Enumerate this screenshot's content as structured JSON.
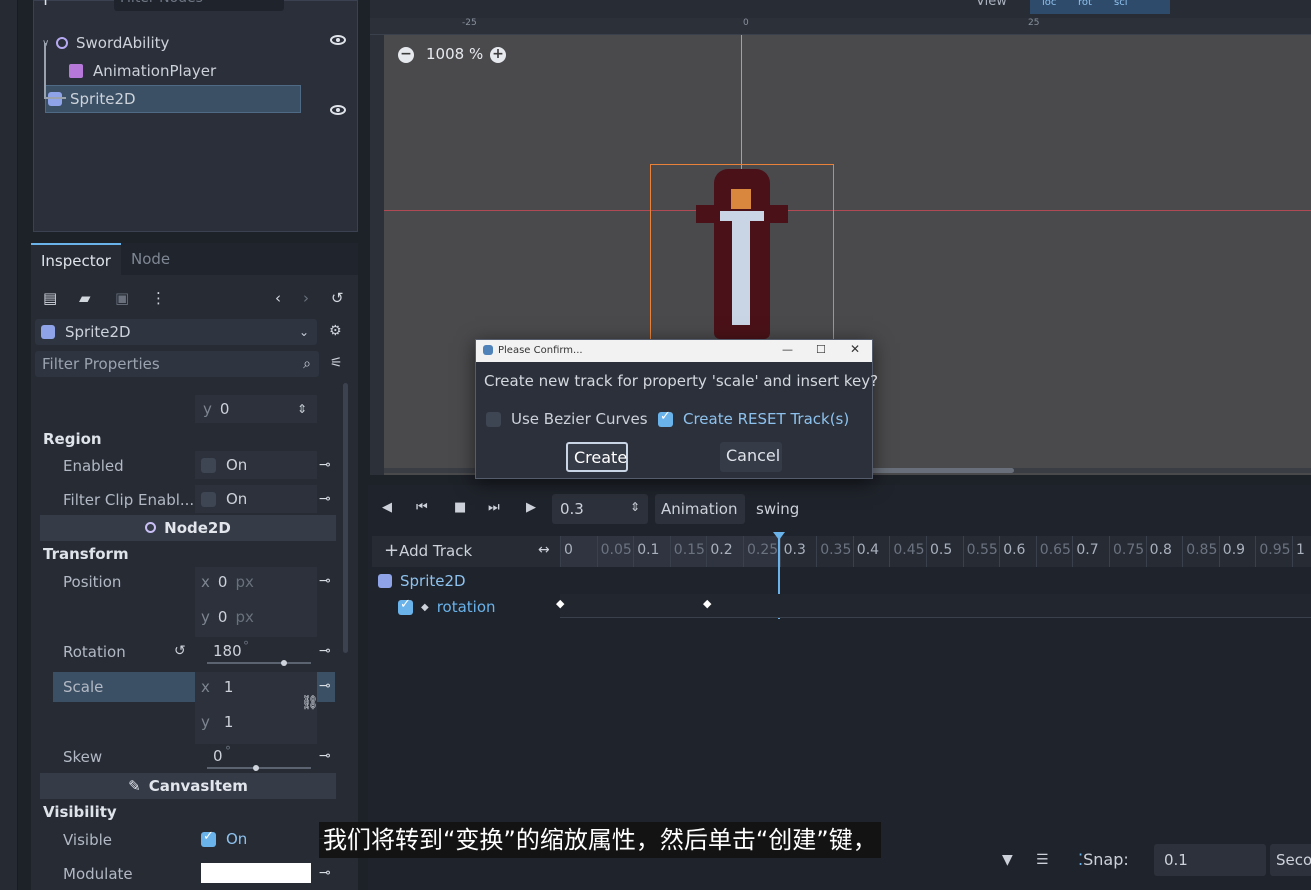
{
  "scene": {
    "filter_placeholder": "Filter Nodes",
    "tree": [
      {
        "label": "SwordAbility",
        "icon": "node-circle-icon"
      },
      {
        "label": "AnimationPlayer",
        "icon": "animation-player-icon"
      },
      {
        "label": "Sprite2D",
        "icon": "sprite2d-icon"
      }
    ]
  },
  "inspector": {
    "tabs": [
      "Inspector",
      "Node"
    ],
    "node_type": "Sprite2D",
    "filter_placeholder": "Filter Properties",
    "frame_y": {
      "axis": "y",
      "value": "0"
    },
    "region": {
      "title": "Region",
      "enabled_label": "Enabled",
      "enabled_value": "On",
      "filter_clip_label": "Filter Clip Enabl...",
      "filter_clip_value": "On"
    },
    "node2d_category": "Node2D",
    "transform": {
      "title": "Transform",
      "position_label": "Position",
      "position_x": "0",
      "position_y": "0",
      "unit_px": "px",
      "rotation_label": "Rotation",
      "rotation_value": "180",
      "degree": "°",
      "scale_label": "Scale",
      "scale_x": "1",
      "scale_y": "1",
      "skew_label": "Skew",
      "skew_value": "0",
      "x": "x",
      "y": "y"
    },
    "canvasitem_category": "CanvasItem",
    "visibility": {
      "title": "Visibility",
      "visible_label": "Visible",
      "visible_value": "On",
      "modulate_label": "Modulate",
      "modulate_color": "#ffffff"
    }
  },
  "viewport": {
    "top_menu": "View",
    "tools": [
      "loc",
      "rot",
      "scl"
    ],
    "ruler_labels": [
      "-25",
      "0",
      "25"
    ],
    "zoom": "1008 %",
    "colors": {
      "sprite_dark": "#4a1218",
      "sprite_blade": "#c9d4e4",
      "selection": "#e8823b"
    }
  },
  "dialog": {
    "title": "Please Confirm...",
    "message": "Create new track for property 'scale' and insert key?",
    "bezier_label": "Use Bezier Curves",
    "bezier_checked": false,
    "reset_label": "Create RESET Track(s)",
    "reset_checked": true,
    "create_label": "Create",
    "cancel_label": "Cancel"
  },
  "animation": {
    "time_value": "0.3",
    "animation_label": "Animation",
    "animation_name": "swing",
    "add_track_label": "Add Track",
    "ticks": [
      "0",
      "0.05",
      "0.1",
      "0.15",
      "0.2",
      "0.25",
      "0.3",
      "0.35",
      "0.4",
      "0.45",
      "0.5",
      "0.55",
      "0.6",
      "0.65",
      "0.7",
      "0.75",
      "0.8",
      "0.85",
      "0.9",
      "0.95",
      "1"
    ],
    "track_node": "Sprite2D",
    "track_property": "rotation",
    "snap_label": "Snap:",
    "snap_value": "0.1",
    "snap_unit": "Seco"
  },
  "subtitle": "我们将转到“变换”的缩放属性，然后单击“创建”键，",
  "accent": "#6ab2ea"
}
